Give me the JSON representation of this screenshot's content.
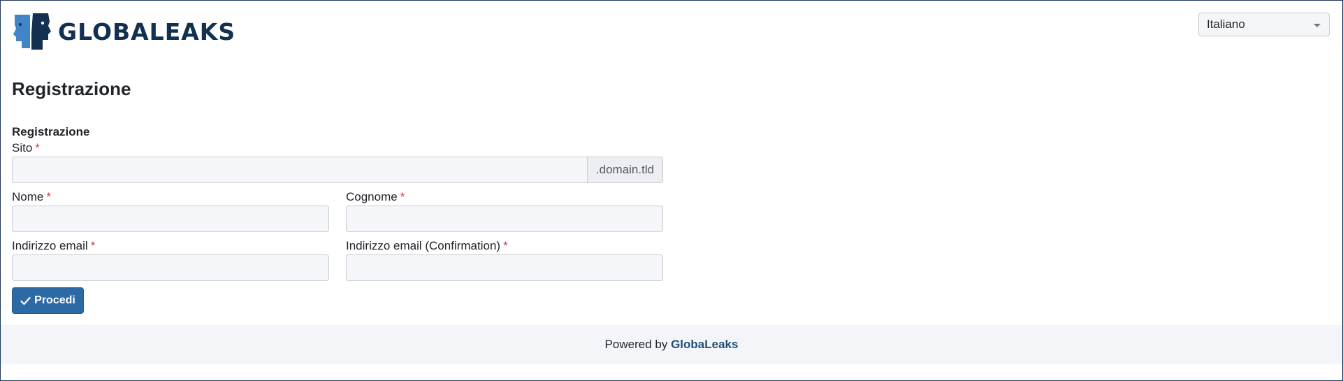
{
  "brand": {
    "name": "GLOBALEAKS",
    "logo_icon": "globaleaks-faces-icon",
    "colors": {
      "primary": "#2c6aa5",
      "dark": "#12304f",
      "required": "#dc3545"
    }
  },
  "language": {
    "selected": "Italiano"
  },
  "page": {
    "title": "Registrazione"
  },
  "form": {
    "section_title": "Registrazione",
    "required_mark": "*",
    "site": {
      "label": "Sito",
      "value": "",
      "suffix": ".domain.tld"
    },
    "first_name": {
      "label": "Nome",
      "value": ""
    },
    "last_name": {
      "label": "Cognome",
      "value": ""
    },
    "email": {
      "label": "Indirizzo email",
      "value": ""
    },
    "email_confirm": {
      "label": "Indirizzo email (Confirmation)",
      "value": ""
    },
    "submit": {
      "label": "Procedi",
      "icon": "check-icon"
    }
  },
  "footer": {
    "powered_by": "Powered by",
    "link_text": "GlobaLeaks"
  }
}
